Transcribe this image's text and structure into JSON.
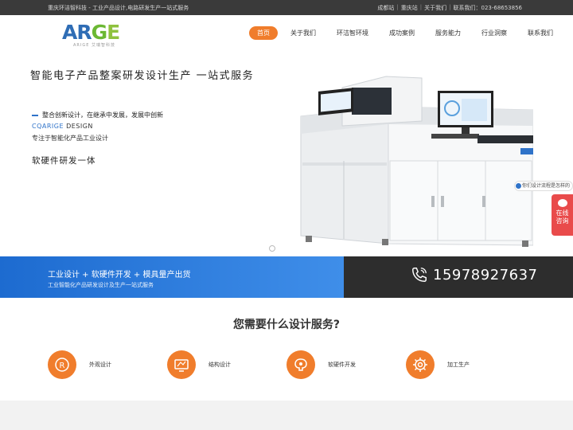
{
  "topbar": {
    "tagline": "重庆环洁智科技 - 工业产品设计,电路研发生产一站式服务",
    "links": [
      "成都站",
      "重庆站",
      "关于我们"
    ],
    "contact": "联系我们：023-68653856"
  },
  "header": {
    "logo_text": "ARGE",
    "logo_sub": "ARIGE 艾瑞智科技",
    "nav": [
      "首页",
      "关于我们",
      "环洁智环境",
      "成功案例",
      "服务能力",
      "行业洞察",
      "联系我们"
    ]
  },
  "hero": {
    "headline": "智能电子产品整案研发设计生产   一站式服务",
    "line1": "整合创新设计，在继承中发展，发展中创新",
    "line2_brand": "CQARIGE",
    "line2_rest": " DESIGN",
    "line3": "专注于智能化产品工业设计",
    "line4": "软硬件研发一体"
  },
  "float": {
    "tip": "你们设计流程是怎样的",
    "consult_1": "在线",
    "consult_2": "咨询"
  },
  "band": {
    "title": "工业设计 + 软硬件开发 + 模具量产出货",
    "subtitle": "工业智能化产品研发设计及生产一站式服务",
    "phone": "15978927637"
  },
  "services": {
    "title": "您需要什么设计服务?",
    "items": [
      {
        "label": "外观设计",
        "icon": "appearance-design-icon"
      },
      {
        "label": "结构设计",
        "icon": "structure-design-icon"
      },
      {
        "label": "软硬件开发",
        "icon": "software-hardware-icon"
      },
      {
        "label": "加工生产",
        "icon": "manufacturing-icon"
      }
    ]
  },
  "colors": {
    "accent": "#f07d2c",
    "blue": "#2f73c9",
    "dark": "#2d2d2d",
    "consult": "#e94b4b"
  }
}
